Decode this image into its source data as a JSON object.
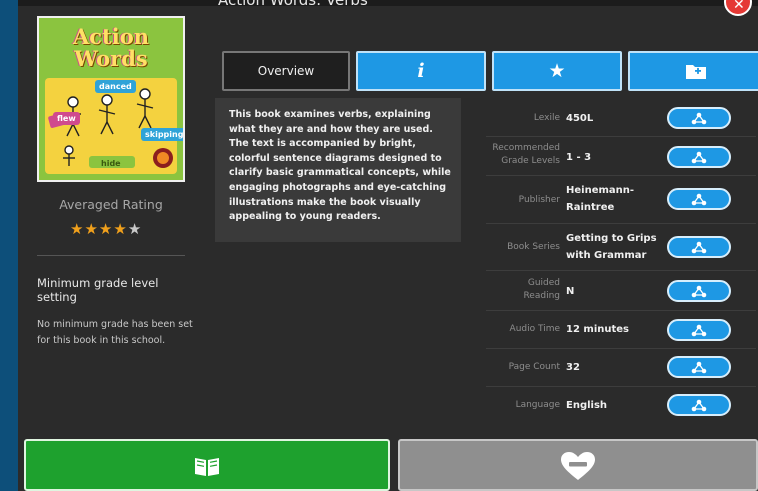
{
  "window": {
    "title": "Action Words: Verbs"
  },
  "cover": {
    "title_line1": "Action",
    "title_line2": "Words",
    "labels": [
      "flew",
      "danced",
      "skipping",
      "hide"
    ]
  },
  "rating": {
    "label": "Averaged Rating",
    "value": 4,
    "max": 5
  },
  "min_grade": {
    "heading": "Minimum grade level setting",
    "text": "No minimum grade has been set for this book in this school."
  },
  "tabs": {
    "overview": "Overview",
    "info": "i",
    "favorite_icon": "star-icon",
    "folder_icon": "folder-add-icon"
  },
  "description": "This book examines verbs, explaining what they are and how they are used. The text is accompanied by bright, colorful sentence diagrams designed to clarify basic grammatical concepts, while engaging photographs and eye-catching illustrations make the book visually appealing to young readers.",
  "details": [
    {
      "label": "Lexile",
      "value": "450L"
    },
    {
      "label": "Recommended Grade Levels",
      "value": "1 - 3"
    },
    {
      "label": "Publisher",
      "value": "Heinemann-Raintree"
    },
    {
      "label": "Book Series",
      "value": "Getting to Grips with Grammar"
    },
    {
      "label": "Guided Reading",
      "value": "N"
    },
    {
      "label": "Audio Time",
      "value": "12 minutes"
    },
    {
      "label": "Page Count",
      "value": "32"
    },
    {
      "label": "Language",
      "value": "English"
    }
  ],
  "buttons": {
    "read_icon": "open-book-icon",
    "remove_icon": "heart-minus-icon"
  },
  "colors": {
    "accent_blue": "#1e98e4",
    "read_green": "#1ea12e",
    "remove_gray": "#8f8f8f",
    "star_orange": "#f0a01c"
  }
}
